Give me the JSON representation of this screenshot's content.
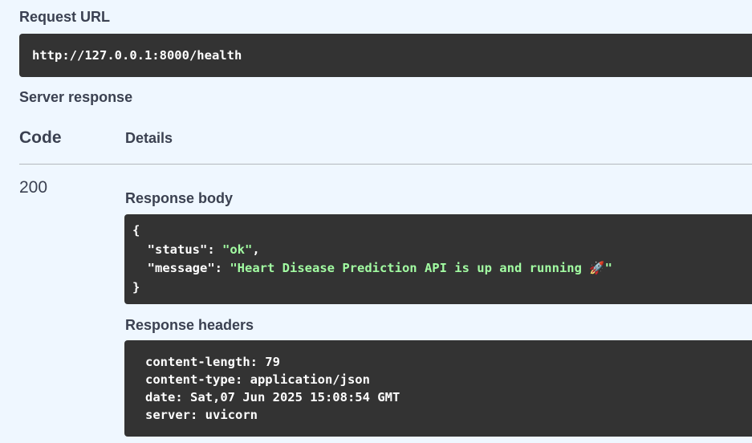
{
  "request_url": {
    "label": "Request URL",
    "value": "http://127.0.0.1:8000/health"
  },
  "server_response": {
    "label": "Server response",
    "columns": {
      "code": "Code",
      "details": "Details"
    },
    "status_code": "200",
    "response_body": {
      "label": "Response body",
      "open_brace": "{",
      "close_brace": "}",
      "fields": [
        {
          "key": "\"status\"",
          "value": "\"ok\"",
          "trailing": ","
        },
        {
          "key": "\"message\"",
          "value_text": "\"Heart Disease Prediction API is up and running ",
          "emoji": "🚀",
          "value_close": "\""
        }
      ]
    },
    "response_headers": {
      "label": "Response headers",
      "lines": [
        "content-length: 79",
        "content-type: application/json",
        "date: Sat,07 Jun 2025 15:08:54 GMT",
        "server: uvicorn"
      ]
    }
  },
  "colors": {
    "background": "#eff7ff",
    "code_block_bg": "#333333",
    "json_string": "#a2fca2",
    "text": "#3b4151"
  }
}
